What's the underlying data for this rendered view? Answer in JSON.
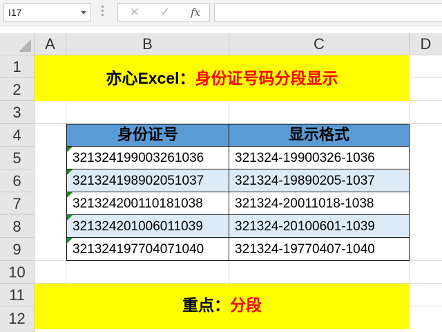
{
  "formula_bar": {
    "name_box": "I17",
    "cancel_glyph": "✕",
    "enter_glyph": "✓",
    "fx_label": "fx",
    "formula": ""
  },
  "columns": [
    "A",
    "B",
    "C",
    "D"
  ],
  "rows": [
    "1",
    "2",
    "3",
    "4",
    "5",
    "6",
    "7",
    "8",
    "9",
    "10",
    "11",
    "12"
  ],
  "title_banner": {
    "black": "亦心Excel：",
    "red": "身份证号码分段显示"
  },
  "table": {
    "headers": [
      "身份证号",
      "显示格式"
    ],
    "rows": [
      [
        "321324199003261036",
        "321324-19900326-1036"
      ],
      [
        "321324198902051037",
        "321324-19890205-1037"
      ],
      [
        "321324200110181038",
        "321324-20011018-1038"
      ],
      [
        "321324201006011039",
        "321324-20100601-1039"
      ],
      [
        "321324197704071040",
        "321324-19770407-1040"
      ]
    ]
  },
  "key_banner": {
    "black": "重点：",
    "red": "分段"
  },
  "colors": {
    "banner_fill": "#ffff00",
    "accent_red": "#ff0000",
    "header_fill": "#5b9bd5",
    "stripe_fill": "#ddebf7"
  }
}
